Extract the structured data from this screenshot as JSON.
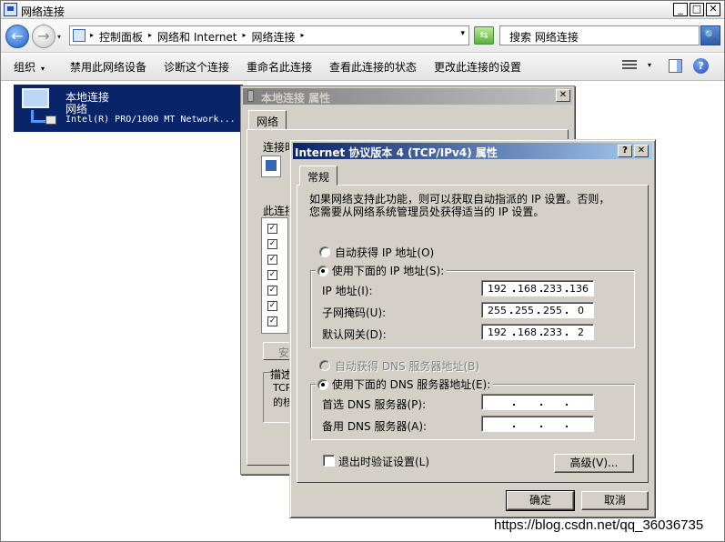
{
  "window": {
    "title": "网络连接",
    "caption": {
      "minimize": "_",
      "maximize": "□",
      "close": "✕"
    }
  },
  "address_bar": {
    "back": "←",
    "forward": "→",
    "history": "▾",
    "crumbs": [
      "控制面板",
      "网络和 Internet",
      "网络连接"
    ],
    "crumb_sep": "▸",
    "crumb_tail": "▸",
    "dropdown": "▾",
    "refresh": "⇆",
    "search_placeholder": "搜索 网络连接",
    "search_icon": "🔍"
  },
  "command_bar": {
    "items": [
      "组织",
      "禁用此网络设备",
      "诊断这个连接",
      "重命名此连接",
      "查看此连接的状态",
      "更改此连接的设置"
    ],
    "organize_arrow": "▾",
    "view_arrow": "▾",
    "help": "?"
  },
  "adapter": {
    "name": "本地连接",
    "status": "网络",
    "device": "Intel(R) PRO/1000 MT Network..."
  },
  "local_properties": {
    "title": "本地连接 属性",
    "close": "✕",
    "tab": "网络",
    "connect_using_fragment": "连接时",
    "components_fragment": "此连接",
    "install_fragment": "安",
    "description_fragment": "描述",
    "desc_line1": "TCP",
    "desc_line2": "的核",
    "check": "✓"
  },
  "ipv4_dialog": {
    "title": "Internet 协议版本 4 (TCP/IPv4) 属性",
    "help": "?",
    "close": "✕",
    "tab": "常规",
    "description": {
      "line1": "如果网络支持此功能，则可以获取自动指派的 IP 设置。否则，",
      "line2": "您需要从网络系统管理员处获得适当的 IP 设置。"
    },
    "ip": {
      "auto_label": "自动获得 IP 地址(O)",
      "manual_label": "使用下面的 IP 地址(S):",
      "address_label": "IP 地址(I):",
      "subnet_label": "子网掩码(U):",
      "gateway_label": "默认网关(D):",
      "address": [
        "192",
        "168",
        "233",
        "136"
      ],
      "subnet": [
        "255",
        "255",
        "255",
        "0"
      ],
      "gateway": [
        "192",
        "168",
        "233",
        "2"
      ]
    },
    "dns": {
      "auto_label": "自动获得 DNS 服务器地址(B)",
      "manual_label": "使用下面的 DNS 服务器地址(E):",
      "preferred_label": "首选 DNS 服务器(P):",
      "alternate_label": "备用 DNS 服务器(A):",
      "preferred": [
        "",
        "",
        "",
        ""
      ],
      "alternate": [
        "",
        "",
        "",
        ""
      ]
    },
    "validate_label": "退出时验证设置(L)",
    "advanced_button": "高级(V)...",
    "ok_button": "确定",
    "cancel_button": "取消",
    "dot": "."
  },
  "watermark": "https://blog.csdn.net/qq_36036735"
}
